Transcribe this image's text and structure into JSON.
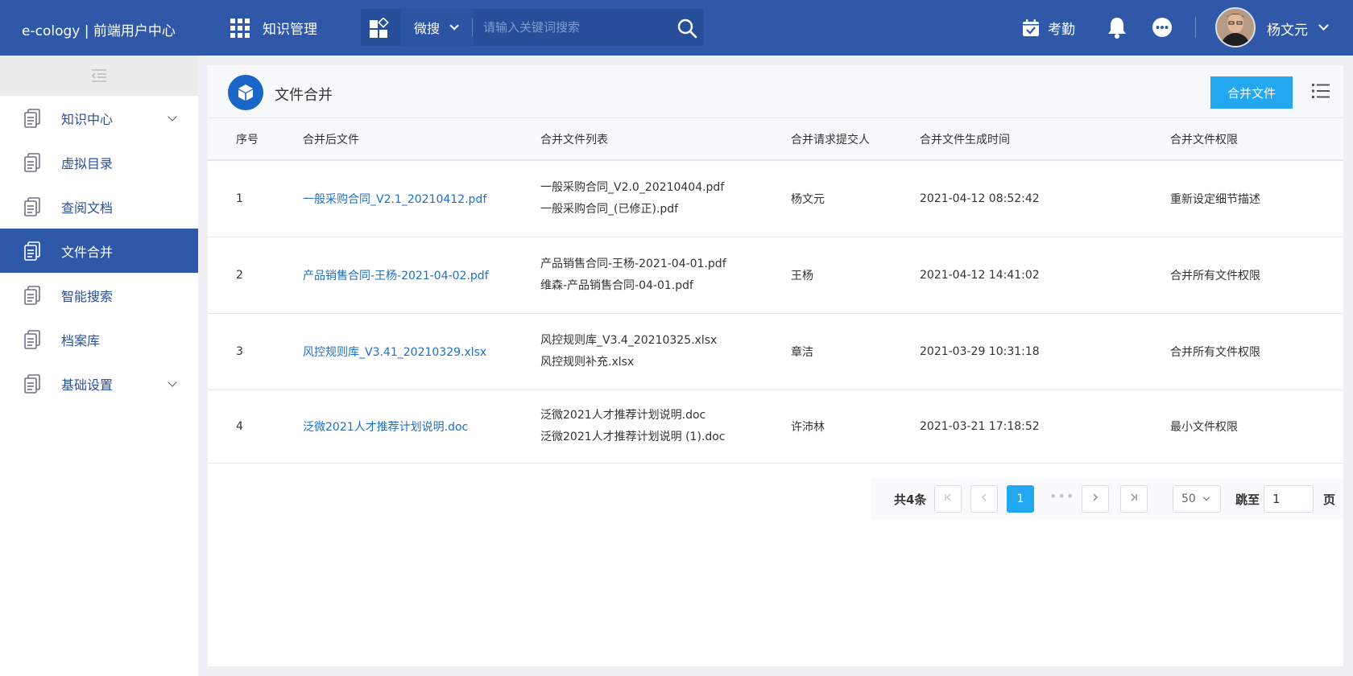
{
  "topbar": {
    "brand": "e-cology | 前端用户中心",
    "app_label": "知识管理",
    "search_scope": "微搜",
    "search_placeholder": "请输入关键词搜索",
    "attendance_label": "考勤",
    "username": "杨文元"
  },
  "sidebar": {
    "items": [
      {
        "label": "知识中心",
        "has_children": true
      },
      {
        "label": "虚拟目录",
        "has_children": false
      },
      {
        "label": "查阅文档",
        "has_children": false
      },
      {
        "label": "文件合并",
        "has_children": false,
        "active": true
      },
      {
        "label": "智能搜索",
        "has_children": false
      },
      {
        "label": "档案库",
        "has_children": false
      },
      {
        "label": "基础设置",
        "has_children": true
      }
    ]
  },
  "panel": {
    "title": "文件合并",
    "merge_button": "合并文件"
  },
  "table": {
    "headers": [
      "序号",
      "合并后文件",
      "合并文件列表",
      "合并请求提交人",
      "合并文件生成时间",
      "合并文件权限"
    ],
    "rows": [
      {
        "no": "1",
        "merged_file": "一般采购合同_V2.1_20210412.pdf",
        "files": [
          "一般采购合同_V2.0_20210404.pdf",
          "一般采购合同_(已修正).pdf"
        ],
        "submitter": "杨文元",
        "time": "2021-04-12 08:52:42",
        "permission": "重新设定细节描述"
      },
      {
        "no": "2",
        "merged_file": "产品销售合同-王杨-2021-04-02.pdf",
        "files": [
          "产品销售合同-王杨-2021-04-01.pdf",
          "维森-产品销售合同-04-01.pdf"
        ],
        "submitter": "王杨",
        "time": "2021-04-12 14:41:02",
        "permission": "合并所有文件权限"
      },
      {
        "no": "3",
        "merged_file": "风控规则库_V3.41_20210329.xlsx",
        "files": [
          "风控规则库_V3.4_20210325.xlsx",
          "风控规则补充.xlsx"
        ],
        "submitter": "章洁",
        "time": "2021-03-29 10:31:18",
        "permission": "合并所有文件权限"
      },
      {
        "no": "4",
        "merged_file": "泛微2021人才推荐计划说明.doc",
        "files": [
          "泛微2021人才推荐计划说明.doc",
          "泛微2021人才推荐计划说明 (1).doc"
        ],
        "submitter": "许沛林",
        "time": "2021-03-21 17:18:52",
        "permission": "最小文件权限"
      }
    ]
  },
  "pagination": {
    "total": "共4条",
    "current_page": "1",
    "page_size": "50",
    "jump_label": "跳至",
    "jump_value": "1",
    "page_unit": "页"
  },
  "colors": {
    "topbar": "#2f59a8",
    "accent": "#22a7f0",
    "link": "#1f6fc4"
  }
}
